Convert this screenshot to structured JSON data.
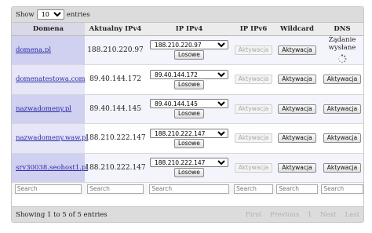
{
  "length_menu": {
    "prefix": "Show",
    "selected": "10",
    "suffix": "entries"
  },
  "columns": [
    "Domena",
    "Aktualny IPv4",
    "IP IPv4",
    "IP IPv6",
    "Wildcard",
    "DNS"
  ],
  "rows": [
    {
      "domain": "domena.pl",
      "ip": "188.210.220.97",
      "select": "188.210.220.97",
      "losowe": "Losowe",
      "ipv6": "Aktywacja",
      "wildcard": "Aktywacja",
      "dns_status": "Żądanie wysłane"
    },
    {
      "domain": "domenatestowa.com",
      "ip": "89.40.144.172",
      "select": "89.40.144.172",
      "losowe": "Losowe",
      "ipv6": "Aktywacja",
      "wildcard": "Aktywacja",
      "dns": "Aktywacja"
    },
    {
      "domain": "nazwadomeny.pl",
      "ip": "89.40.144.145",
      "select": "89.40.144.145",
      "losowe": "Losowe",
      "ipv6": "Aktywacja",
      "wildcard": "Aktywacja",
      "dns": "Aktywacja"
    },
    {
      "domain": "nazwadomeny.waw.pl",
      "ip": "188.210.222.147",
      "select": "188.210.222.147",
      "losowe": "Losowe",
      "ipv6": "Aktywacja",
      "wildcard": "Aktywacja",
      "dns": "Aktywacja"
    },
    {
      "domain": "srv30038.seohost1.pl",
      "ip": "188.210.222.147",
      "select": "188.210.222.147",
      "losowe": "Losowe",
      "ipv6": "Aktywacja",
      "wildcard": "Aktywacja",
      "dns": "Aktywacja"
    }
  ],
  "search_placeholder": "Search",
  "info": "Showing 1 to 5 of 5 entries",
  "pagination": {
    "first": "First",
    "previous": "Previous",
    "page": "1",
    "next": "Next",
    "last": "Last"
  }
}
